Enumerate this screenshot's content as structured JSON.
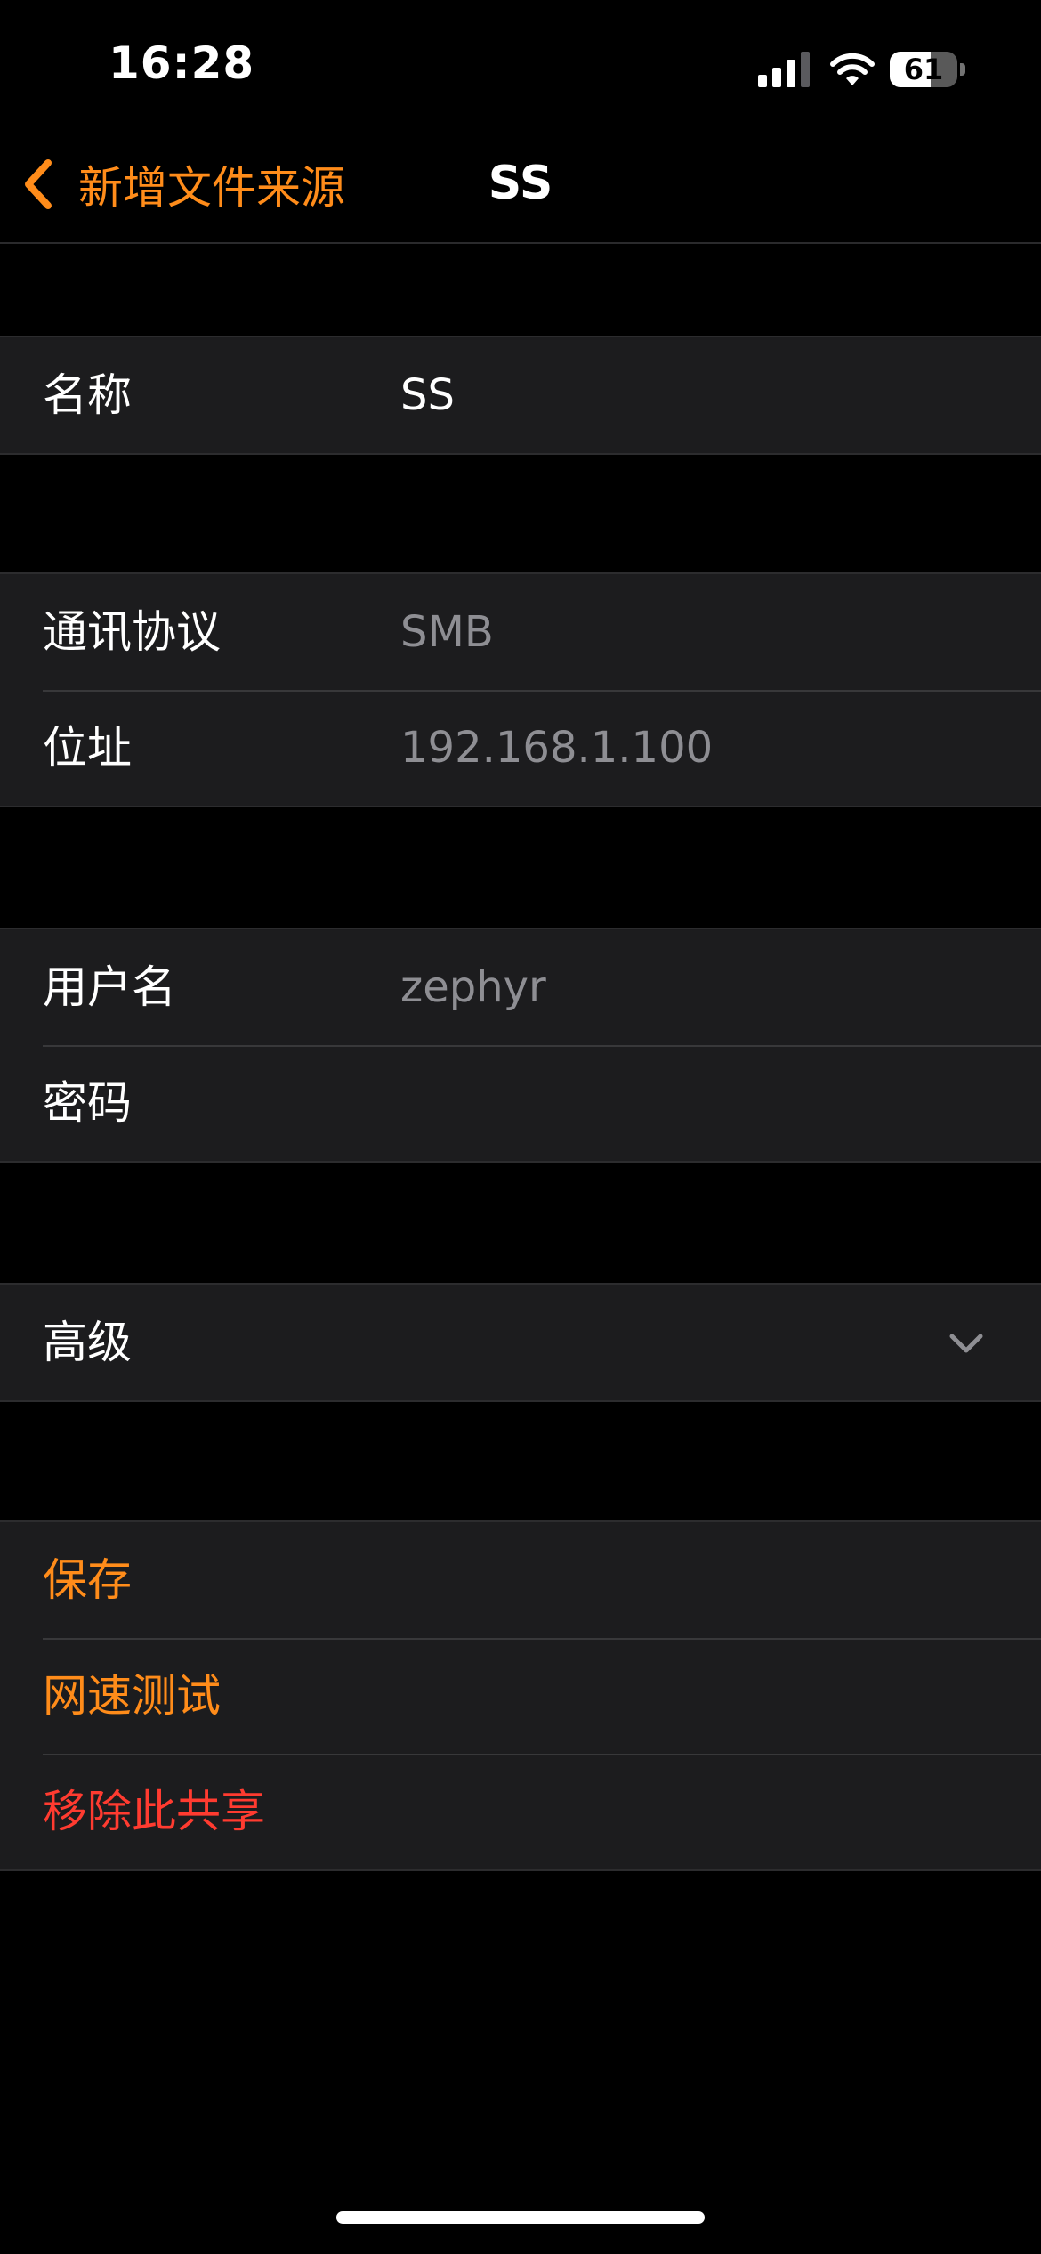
{
  "status_bar": {
    "time": "16:28",
    "battery_level": "61",
    "battery_fraction": 0.61,
    "icons": [
      "cellular-signal-icon",
      "wifi-icon",
      "battery-icon"
    ]
  },
  "nav": {
    "back_label": "新增文件来源",
    "title": "SS",
    "back_icon": "chevron-left-icon"
  },
  "colors": {
    "accent": "#ff8c1a",
    "destructive": "#ff3b30",
    "background": "#000000",
    "cell": "#1c1c1e",
    "secondary_text": "#8e8e93"
  },
  "form": {
    "name": {
      "label": "名称",
      "value": "SS"
    },
    "protocol": {
      "label": "通讯协议",
      "value": "SMB"
    },
    "address": {
      "label": "位址",
      "value": "192.168.1.100"
    },
    "username": {
      "label": "用户名",
      "value": "zephyr"
    },
    "password": {
      "label": "密码",
      "value": ""
    },
    "advanced": {
      "label": "高级",
      "icon": "chevron-down-icon"
    }
  },
  "actions": {
    "save": "保存",
    "speed_test": "网速测试",
    "remove_share": "移除此共享"
  }
}
